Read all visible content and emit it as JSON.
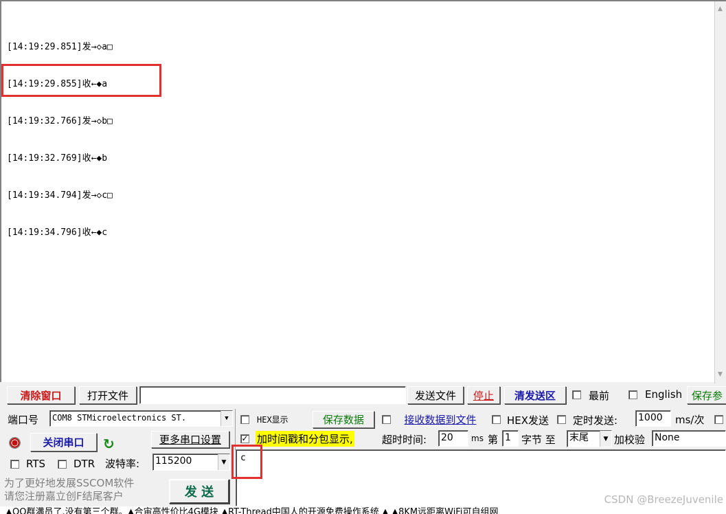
{
  "receive": {
    "lines": [
      "[14:19:29.851]发→◇a□",
      "[14:19:29.855]收←◆a",
      "[14:19:32.766]发→◇b□",
      "[14:19:32.769]收←◆b",
      "[14:19:34.794]发→◇c□",
      "[14:19:34.796]收←◆c"
    ]
  },
  "toolbar1": {
    "clear_window": "清除窗口",
    "open_file": "打开文件",
    "file_path": "",
    "send_file": "发送文件",
    "stop": "停止",
    "clear_send": "清发送区",
    "topmost": "最前",
    "english": "English",
    "save_params": "保存参"
  },
  "toolbar2": {
    "port_label": "端口号",
    "port_value": "COM8 STMicroelectronics ST.",
    "hex_display": "HEX显示",
    "save_data": "保存数据",
    "recv_to_file": "接收数据到文件",
    "hex_send": "HEX发送",
    "timed_send": "定时发送:",
    "interval": "1000",
    "interval_unit": "ms/次"
  },
  "toolbar3": {
    "close_port": "关闭串口",
    "more_settings": "更多串口设置",
    "timestamp": "加时间戳和分包显示,",
    "timeout_label": "超时时间:",
    "timeout_value": "20",
    "timeout_unit": "ms",
    "nth_label": "第",
    "nth_value": "1",
    "byte_label": "字节 至",
    "end_value": "末尾",
    "checksum_label": "加校验",
    "checksum_value": "None"
  },
  "toolbar4": {
    "rts": "RTS",
    "dtr": "DTR",
    "baud_label": "波特率:",
    "baud_value": "115200"
  },
  "send": {
    "text": "c",
    "send_button": "发  送"
  },
  "promo": {
    "line1": "为了更好地发展SSCOM软件",
    "line2": "请您注册嘉立创F结尾客户"
  },
  "status_bar": "▲QQ群满员了,没有第三个群。▲合宙高性价比4G模块 ▲RT-Thread中国人的开源免费操作系统 ▲ ▲8KM远距离WiFi可自组网",
  "watermark": "CSDN @BreezeJuvenile",
  "colors": {
    "highlight": "#e03030",
    "button_red": "#c81818",
    "button_blue": "#1a1aa8",
    "timestamp_bg": "#ffff00"
  }
}
